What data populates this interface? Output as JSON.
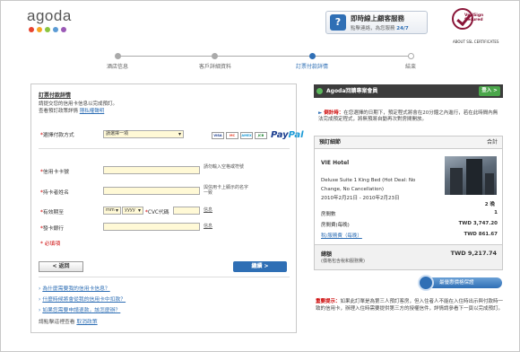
{
  "header": {
    "logo": "agoda",
    "logo_dot_colors": [
      "#e8442e",
      "#f5a623",
      "#8bc53f",
      "#5b9bd5",
      "#9b59b6"
    ],
    "cs_title": "即時線上顧客服務",
    "cs_sub": "點擊連絡，為您服務",
    "cs_hours": "24/7",
    "verisign_label": "VeriSign Secured",
    "verisign_about": "ABOUT SSL CERTIFICATES"
  },
  "steps": [
    {
      "label": "酒店信息",
      "state": "done"
    },
    {
      "label": "客戶詳細資料",
      "state": "done"
    },
    {
      "label": "訂票付款詳情",
      "state": "active"
    },
    {
      "label": "結束",
      "state": "todo"
    }
  ],
  "form": {
    "title": "訂票付款詳情",
    "intro_line1": "請提交您的信用卡信息以完成預訂。",
    "intro_line2_prefix": "查看預訂政策詳情 ",
    "intro_link": "隱私權聲明",
    "payment_method_label": "選擇付款方式",
    "payment_method_value": "請選擇一項",
    "card_logos": [
      "VISA",
      "MC",
      "AMEX",
      "JCB"
    ],
    "paypal": "PayPal",
    "card_number_label": "信用卡卡號",
    "card_number_note": "請勿輸入空格或符號",
    "holder_label": "持卡者姓名",
    "holder_note": "與信用卡上顯示的名字一致",
    "expiry_label": "有效期至",
    "expiry_mm": "mm",
    "expiry_yy": "yyyy",
    "cvc_label": "CVC代碼",
    "cvc_link": "信息",
    "bank_label": "發卡銀行",
    "bank_link": "信息",
    "required_note": "必填項",
    "back_button": "< 返回",
    "continue_button": "繼續 >",
    "faq": [
      "為什麼需要我的信用卡信息？",
      "什麼時候將會從我的信用卡中扣款？",
      "如果您需要申請退款，該怎麼辦？"
    ],
    "help_prefix": "請點擊這裡查看 ",
    "help_link": "取消政策"
  },
  "member": {
    "title": "Agoda回饋專案會員",
    "join": "登入 >"
  },
  "timer": {
    "lead": "倒計時：",
    "text": "在您選擇的日期下，預定程式將會在20分鐘之內進行，若在此時間內無法完成預定程式，將無預將自動再次對房間開放。"
  },
  "booking": {
    "title": "預訂細節",
    "total_label": "合計",
    "hotel": "VIE Hotel",
    "room_line1": "Deluxe Suite 1 King Bed (Hot Deal: No",
    "room_line2": "Change, No Cancellation)",
    "dates": "2010年2月21日 - 2010年2月23日",
    "nights": "2 晚",
    "rooms_label": "房間數",
    "rooms_value": "1",
    "room_rate_label": "房間費(每晚)",
    "room_rate_value": "TWD 3,747.20",
    "tax_label": "稅/服務費（每晚）",
    "tax_value": "TWD 861.67",
    "grand_label": "總額",
    "grand_note": "(價格包含稅和服務費)",
    "grand_value": "TWD 9,217.74"
  },
  "guarantee": "最優惠價格保證",
  "important": {
    "lead": "重要提示：",
    "text": "如果此訂單是為第三人預訂客房，但入住者人不能在入住時出示與付款時一致的信用卡，辦理入住時需要提供第三方的授權信件，詳情請參看下一頁以完成預訂。"
  }
}
